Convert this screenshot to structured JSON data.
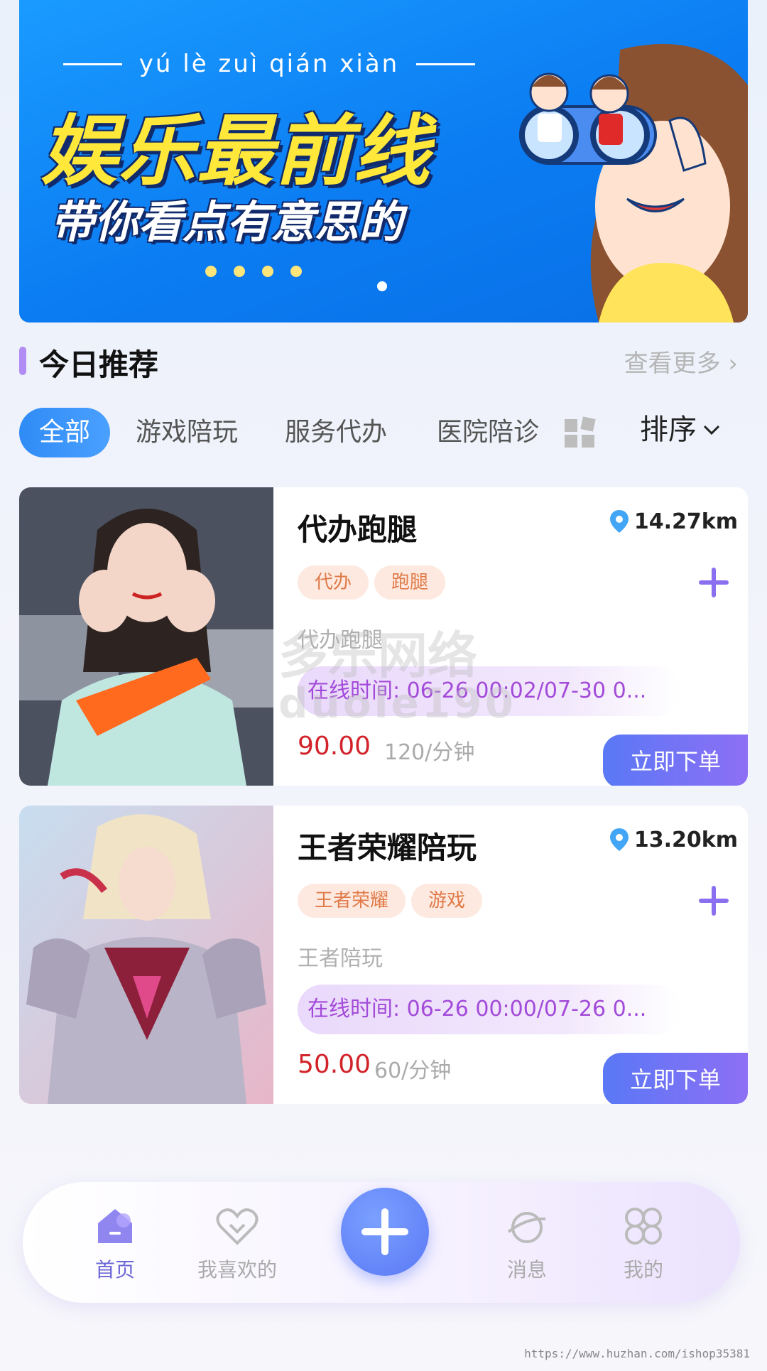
{
  "banner": {
    "pinyin": "yú lè zuì qián xiàn",
    "title": "娱乐最前线",
    "subtitle": "带你看点有意思的"
  },
  "section": {
    "title": "今日推荐",
    "see_more": "查看更多"
  },
  "tabs": [
    {
      "label": "全部",
      "active": true
    },
    {
      "label": "游戏陪玩",
      "active": false
    },
    {
      "label": "服务代办",
      "active": false
    },
    {
      "label": "医院陪诊",
      "active": false
    }
  ],
  "sort_label": "排序",
  "cards": [
    {
      "title": "代办跑腿",
      "distance": "14.27km",
      "tags": [
        "代办",
        "跑腿"
      ],
      "desc": "代办跑腿",
      "online": "在线时间: 06-26 00:02/07-30 0...",
      "price": "90.00",
      "unit": "120/分钟",
      "button": "立即下单"
    },
    {
      "title": "王者荣耀陪玩",
      "distance": "13.20km",
      "tags": [
        "王者荣耀",
        "游戏"
      ],
      "desc": "王者陪玩",
      "online": "在线时间: 06-26 00:00/07-26 0...",
      "price": "50.00",
      "unit": "60/分钟",
      "button": "立即下单"
    }
  ],
  "watermark": {
    "line1": "多乐网络",
    "line2": "duole190"
  },
  "nav": [
    {
      "label": "首页",
      "icon": "home-icon",
      "active": true
    },
    {
      "label": "我喜欢的",
      "icon": "heart-icon",
      "active": false
    },
    {
      "label": "消息",
      "icon": "planet-icon",
      "active": false
    },
    {
      "label": "我的",
      "icon": "clover-icon",
      "active": false
    }
  ],
  "footer_url": "https://www.huzhan.com/ishop35381",
  "colors": {
    "accent": "#2f8bf5",
    "purple": "#8d6ff5",
    "price": "#d2232a",
    "tag_text": "#e07a48"
  }
}
